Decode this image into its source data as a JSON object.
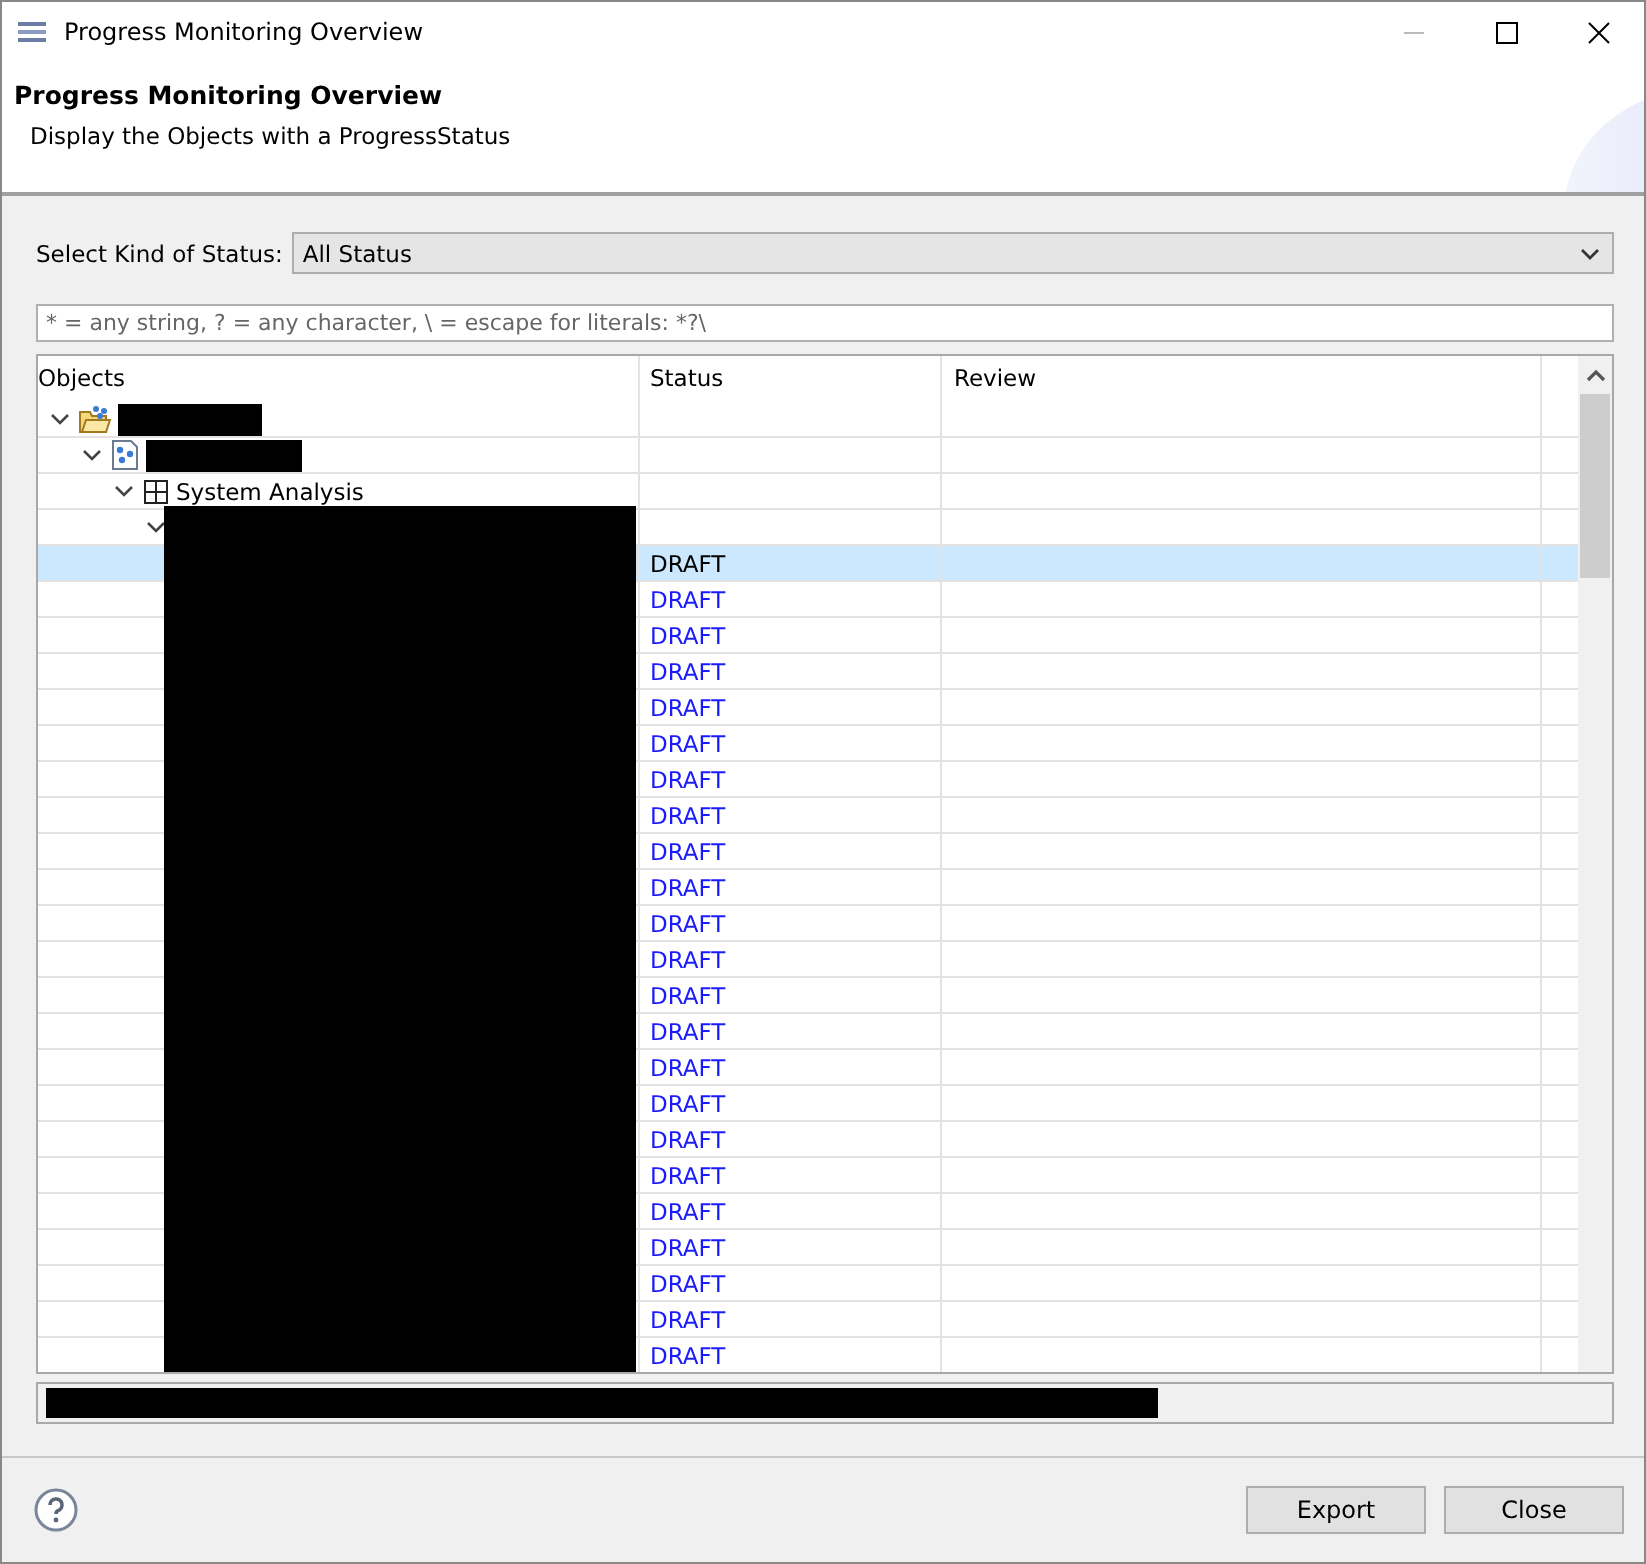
{
  "window": {
    "title": "Progress Monitoring Overview"
  },
  "header": {
    "title": "Progress Monitoring Overview",
    "description": "Display the Objects with a ProgressStatus"
  },
  "status_select": {
    "label": "Select Kind of Status:",
    "value": "All Status"
  },
  "filter": {
    "placeholder": "* = any string, ? = any character, \\ = escape for literals: *?\\"
  },
  "table": {
    "columns": [
      "Objects",
      "Status",
      "Review"
    ],
    "rows": [
      {
        "kind": "folder",
        "redacted": true,
        "expanded": true,
        "children": [
          {
            "kind": "document",
            "redacted": true,
            "expanded": true,
            "children": [
              {
                "kind": "grid",
                "label": "System Analysis",
                "expanded": true,
                "children": [
                  {
                    "redacted": true,
                    "expanded": true,
                    "children": [
                      {
                        "redacted": true,
                        "status": "DRAFT",
                        "selected": true
                      },
                      {
                        "redacted": true,
                        "status": "DRAFT",
                        "selected": false
                      },
                      {
                        "redacted": true,
                        "status": "DRAFT",
                        "selected": false
                      },
                      {
                        "redacted": true,
                        "status": "DRAFT",
                        "selected": false
                      },
                      {
                        "redacted": true,
                        "status": "DRAFT",
                        "selected": false
                      },
                      {
                        "redacted": true,
                        "status": "DRAFT",
                        "selected": false
                      },
                      {
                        "redacted": true,
                        "status": "DRAFT",
                        "selected": false
                      },
                      {
                        "redacted": true,
                        "status": "DRAFT",
                        "selected": false
                      },
                      {
                        "redacted": true,
                        "status": "DRAFT",
                        "selected": false
                      },
                      {
                        "redacted": true,
                        "status": "DRAFT",
                        "selected": false
                      },
                      {
                        "redacted": true,
                        "status": "DRAFT",
                        "selected": false
                      },
                      {
                        "redacted": true,
                        "status": "DRAFT",
                        "selected": false
                      },
                      {
                        "redacted": true,
                        "status": "DRAFT",
                        "selected": false
                      },
                      {
                        "redacted": true,
                        "status": "DRAFT",
                        "selected": false
                      },
                      {
                        "redacted": true,
                        "status": "DRAFT",
                        "selected": false
                      },
                      {
                        "redacted": true,
                        "status": "DRAFT",
                        "selected": false
                      },
                      {
                        "redacted": true,
                        "status": "DRAFT",
                        "selected": false
                      },
                      {
                        "redacted": true,
                        "status": "DRAFT",
                        "selected": false
                      },
                      {
                        "redacted": true,
                        "status": "DRAFT",
                        "selected": false
                      },
                      {
                        "redacted": true,
                        "status": "DRAFT",
                        "selected": false
                      },
                      {
                        "redacted": true,
                        "status": "DRAFT",
                        "selected": false
                      },
                      {
                        "redacted": true,
                        "status": "DRAFT",
                        "selected": false
                      },
                      {
                        "redacted": true,
                        "status": "DRAFT",
                        "selected": false
                      }
                    ]
                  }
                ]
              }
            ]
          }
        ]
      }
    ]
  },
  "path_field": {
    "redacted": true
  },
  "buttons": [
    "Export",
    "Close"
  ]
}
